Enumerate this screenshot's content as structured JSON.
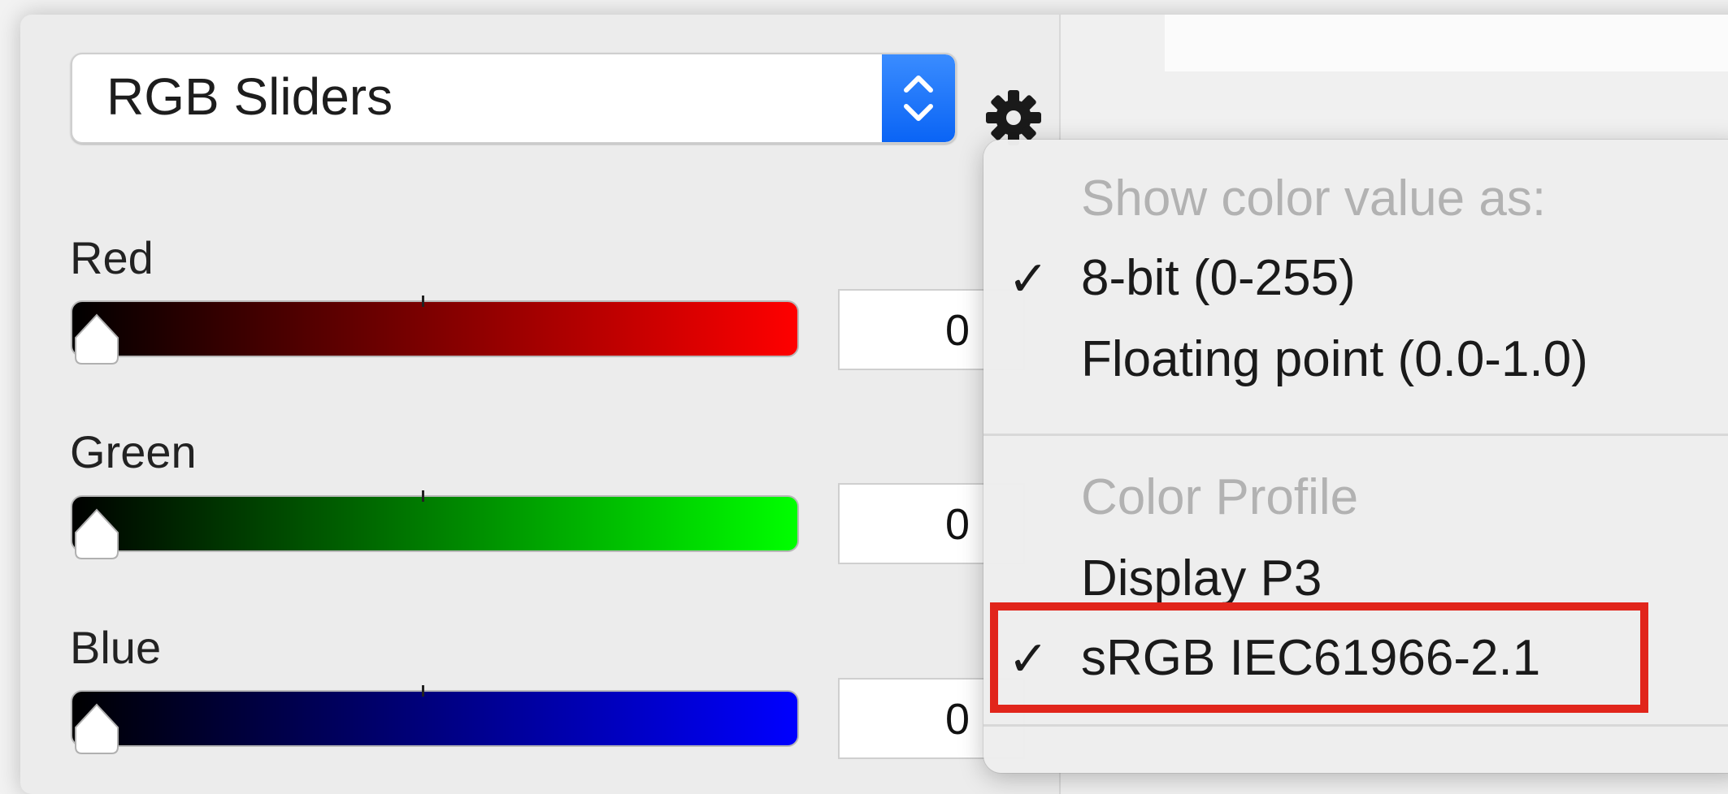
{
  "color_picker": {
    "mode_select": {
      "selected": "RGB Sliders"
    },
    "gear_icon": "gear-icon",
    "sliders": [
      {
        "label": "Red",
        "value": "0",
        "level": 0.0,
        "color": "#ff0000"
      },
      {
        "label": "Green",
        "value": "0",
        "level": 0.0,
        "color": "#00ff00"
      },
      {
        "label": "Blue",
        "value": "0",
        "level": 0.0,
        "color": "#0000ff"
      }
    ]
  },
  "menu": {
    "section1_header": "Show color value as:",
    "items1": [
      {
        "label": "8-bit (0-255)",
        "checked": true
      },
      {
        "label": "Floating point (0.0-1.0)",
        "checked": false
      }
    ],
    "section2_header": "Color Profile",
    "items2": [
      {
        "label": "Display P3",
        "checked": false
      },
      {
        "label": "sRGB IEC61966-2.1",
        "checked": true
      }
    ],
    "check_glyph": "✓"
  },
  "highlight_color": "#e1251b"
}
